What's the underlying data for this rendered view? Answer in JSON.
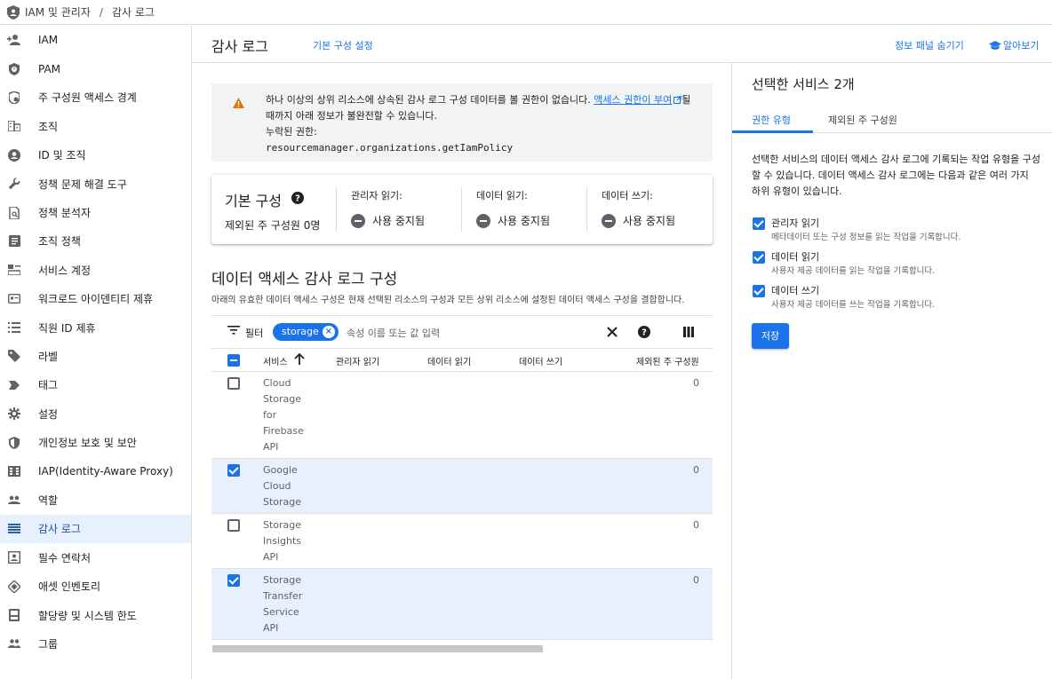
{
  "breadcrumb": {
    "root": "IAM 및 관리자",
    "separator": "/",
    "current": "감사 로그"
  },
  "sidebar": {
    "items": [
      {
        "label": "IAM",
        "icon": "person-add-icon"
      },
      {
        "label": "PAM",
        "icon": "shield-clock-icon"
      },
      {
        "label": "주 구성원 액세스 경계",
        "icon": "boundary-shield-icon"
      },
      {
        "label": "조직",
        "icon": "organization-icon"
      },
      {
        "label": "ID 및 조직",
        "icon": "account-circle-icon"
      },
      {
        "label": "정책 문제 해결 도구",
        "icon": "wrench-icon"
      },
      {
        "label": "정책 분석자",
        "icon": "policy-analyzer-icon"
      },
      {
        "label": "조직 정책",
        "icon": "list-document-icon"
      },
      {
        "label": "서비스 계정",
        "icon": "service-account-icon"
      },
      {
        "label": "워크로드 아이덴티티 제휴",
        "icon": "id-card-icon"
      },
      {
        "label": "직원 ID 제휴",
        "icon": "list-icon"
      },
      {
        "label": "라벨",
        "icon": "label-icon"
      },
      {
        "label": "태그",
        "icon": "tag-icon"
      },
      {
        "label": "설정",
        "icon": "gear-icon"
      },
      {
        "label": "개인정보 보호 및 보안",
        "icon": "privacy-shield-icon"
      },
      {
        "label": "IAP(Identity-Aware Proxy)",
        "icon": "proxy-icon"
      },
      {
        "label": "역할",
        "icon": "roles-icon"
      },
      {
        "label": "감사 로그",
        "icon": "audit-log-icon"
      },
      {
        "label": "필수 연락처",
        "icon": "contact-icon"
      },
      {
        "label": "애셋 인벤토리",
        "icon": "asset-inventory-icon"
      },
      {
        "label": "할당량 및 시스템 한도",
        "icon": "quota-icon"
      },
      {
        "label": "그룹",
        "icon": "group-icon"
      }
    ]
  },
  "header": {
    "title": "감사 로그",
    "default_config_link": "기본 구성 설정",
    "hide_info_panel": "정보 패널 숨기기",
    "learn": "알아보기"
  },
  "warning": {
    "text_before": "하나 이상의 상위 리소스에 상속된 감사 로그 구성 데이터를 볼 권한이 없습니다.",
    "link": "액세스 권한이 부여",
    "text_after": "될 때까지 아래 정보가 불완전할 수 있습니다.",
    "missing_label": "누락된 권한:",
    "permission": "resourcemanager.organizations.getIamPolicy"
  },
  "default_config": {
    "title": "기본 구성",
    "exempted": "제외된 주 구성원 0명",
    "columns": [
      {
        "label": "관리자 읽기:",
        "status": "사용 중지됨"
      },
      {
        "label": "데이터 읽기:",
        "status": "사용 중지됨"
      },
      {
        "label": "데이터 쓰기:",
        "status": "사용 중지됨"
      }
    ]
  },
  "data_access": {
    "title": "데이터 액세스 감사 로그 구성",
    "description": "아래의 유효한 데이터 액세스 구성은 현재 선택된 리소스의 구성과 모든 상위 리소스에 설정된 데이터 액세스 구성을 결합합니다."
  },
  "filter": {
    "label": "필터",
    "chip": "storage",
    "placeholder": "속성 이름 또는 값 입력"
  },
  "table": {
    "columns": [
      "서비스",
      "관리자 읽기",
      "데이터 읽기",
      "데이터 쓰기",
      "제외된 주 구성원"
    ],
    "rows": [
      {
        "service_lines": [
          "Cloud",
          "Storage",
          "for",
          "Firebase",
          "API"
        ],
        "checked": false,
        "exempted": "0"
      },
      {
        "service_lines": [
          "Google",
          "Cloud",
          "Storage"
        ],
        "checked": true,
        "exempted": "0"
      },
      {
        "service_lines": [
          "Storage",
          "Insights",
          "API"
        ],
        "checked": false,
        "exempted": "0"
      },
      {
        "service_lines": [
          "Storage",
          "Transfer",
          "Service",
          "API"
        ],
        "checked": true,
        "exempted": "0"
      }
    ]
  },
  "right_panel": {
    "title": "선택한 서비스 2개",
    "tabs": [
      "권한 유형",
      "제외된 주 구성원"
    ],
    "description": "선택한 서비스의 데이터 액세스 감사 로그에 기록되는 작업 유형을 구성할 수 있습니다. 데이터 액세스 감사 로그에는 다음과 같은 여러 가지 하위 유형이 있습니다.",
    "options": [
      {
        "label": "관리자 읽기",
        "sub": "메타데이터 또는 구성 정보를 읽는 작업을 기록합니다.",
        "checked": true
      },
      {
        "label": "데이터 읽기",
        "sub": "사용자 제공 데이터를 읽는 작업을 기록합니다.",
        "checked": true
      },
      {
        "label": "데이터 쓰기",
        "sub": "사용자 제공 데이터를 쓰는 작업을 기록합니다.",
        "checked": true
      }
    ],
    "save": "저장"
  },
  "colors": {
    "accent": "#1a73e8",
    "selected_row": "#e8f0fe",
    "warning_icon": "#e37400"
  }
}
